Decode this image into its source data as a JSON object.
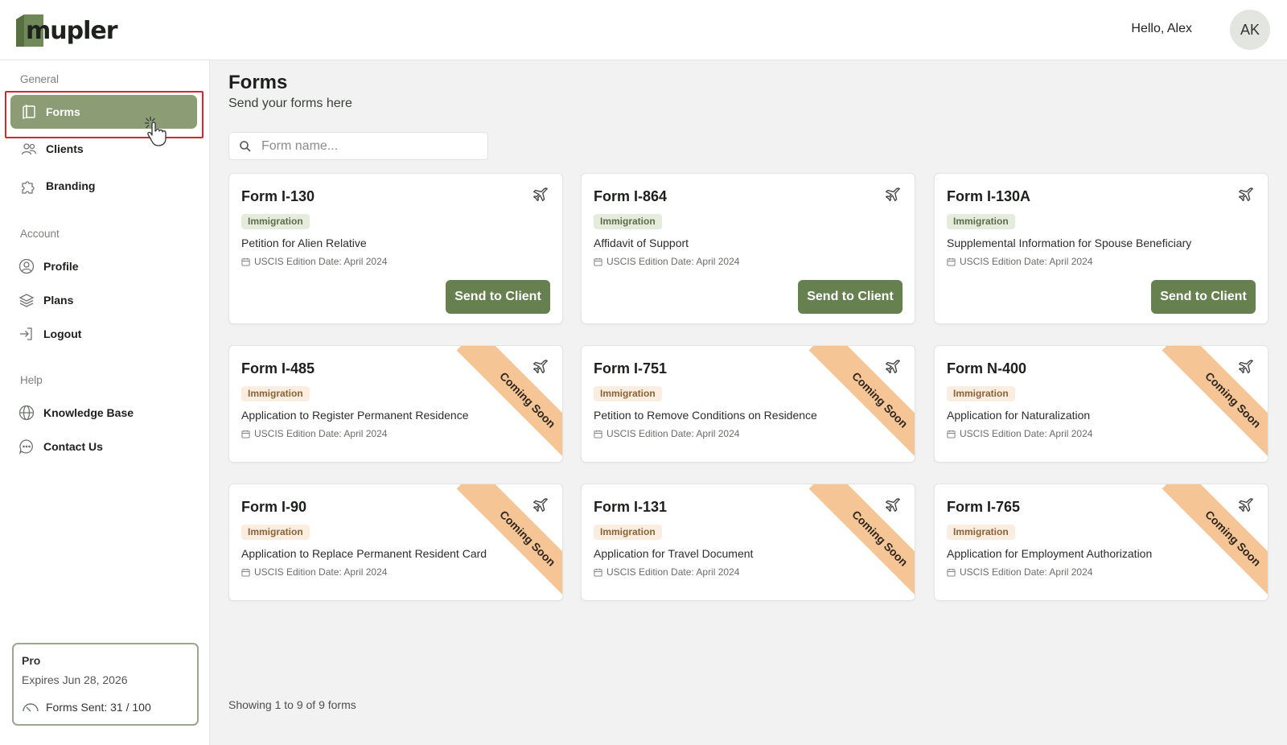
{
  "header": {
    "logo_text": "mupler",
    "greeting": "Hello, Alex",
    "avatar_initials": "AK"
  },
  "sidebar": {
    "sections": [
      {
        "label": "General"
      },
      {
        "label": "Account"
      },
      {
        "label": "Help"
      }
    ],
    "items": [
      {
        "label": "Forms",
        "icon": "forms-icon",
        "active": true
      },
      {
        "label": "Clients",
        "icon": "users-icon"
      },
      {
        "label": "Branding",
        "icon": "puzzle-icon"
      },
      {
        "label": "Profile",
        "icon": "user-circle-icon"
      },
      {
        "label": "Plans",
        "icon": "layers-icon"
      },
      {
        "label": "Logout",
        "icon": "logout-icon"
      },
      {
        "label": "Knowledge Base",
        "icon": "globe-icon"
      },
      {
        "label": "Contact Us",
        "icon": "chat-icon"
      }
    ],
    "plan": {
      "name": "Pro",
      "expiry": "Expires Jun 28, 2026",
      "usage": "Forms Sent: 31 / 100"
    }
  },
  "main": {
    "title": "Forms",
    "subtitle": "Send your forms here",
    "search_placeholder": "Form name...",
    "footer": "Showing 1 to 9 of 9 forms",
    "forms": [
      {
        "title": "Form I-130",
        "tag": "Immigration",
        "description": "Petition for Alien Relative",
        "date": "USCIS Edition Date: April 2024",
        "action": "Send to Client"
      },
      {
        "title": "Form I-864",
        "tag": "Immigration",
        "description": "Affidavit of Support",
        "date": "USCIS Edition Date: April 2024",
        "action": "Send to Client"
      },
      {
        "title": "Form I-130A",
        "tag": "Immigration",
        "description": "Supplemental Information for Spouse Beneficiary",
        "date": "USCIS Edition Date: April 2024",
        "action": "Send to Client"
      },
      {
        "title": "Form I-485",
        "tag": "Immigration",
        "description": "Application to Register Permanent Residence",
        "date": "USCIS Edition Date: April 2024",
        "ribbon": "Coming Soon"
      },
      {
        "title": "Form I-751",
        "tag": "Immigration",
        "description": "Petition to Remove Conditions on Residence",
        "date": "USCIS Edition Date: April 2024",
        "ribbon": "Coming Soon"
      },
      {
        "title": "Form N-400",
        "tag": "Immigration",
        "description": "Application for Naturalization",
        "date": "USCIS Edition Date: April 2024",
        "ribbon": "Coming Soon"
      },
      {
        "title": "Form I-90",
        "tag": "Immigration",
        "description": "Application to Replace Permanent Resident Card",
        "date": "USCIS Edition Date: April 2024",
        "ribbon": "Coming Soon"
      },
      {
        "title": "Form I-131",
        "tag": "Immigration",
        "description": "Application for Travel Document",
        "date": "USCIS Edition Date: April 2024",
        "ribbon": "Coming Soon"
      },
      {
        "title": "Form I-765",
        "tag": "Immigration",
        "description": "Application for Employment Authorization",
        "date": "USCIS Edition Date: April 2024",
        "ribbon": "Coming Soon"
      }
    ]
  },
  "colors": {
    "brand_green": "#66804f",
    "active_nav": "#8c9d76",
    "ribbon": "#f6c596",
    "highlight_outline": "#d9252b"
  }
}
